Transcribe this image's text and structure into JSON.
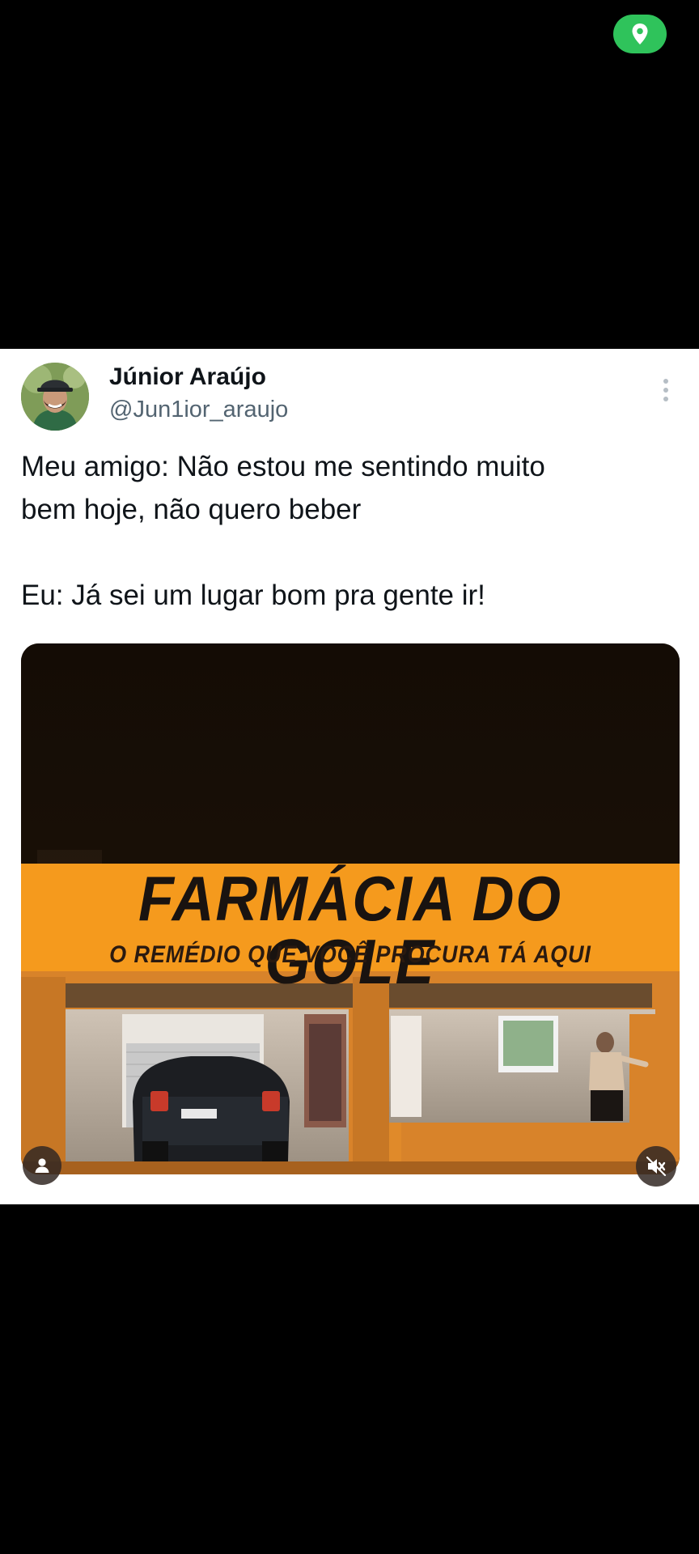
{
  "status": {
    "location_icon": "location-pin-icon",
    "accent": "#2fc35b"
  },
  "tweet": {
    "author_name": "Júnior Araújo",
    "author_handle": "@Jun1ior_araujo",
    "line1": "Meu amigo: Não estou me sentindo muito",
    "line2": "bem hoje, não quero beber",
    "line3": "Eu: Já sei um lugar bom pra gente ir!"
  },
  "media": {
    "sign_title": "FARMÁCIA DO GOLE",
    "sign_subtitle": "O REMÉDIO QUE VOCÊ PROCURA TÁ AQUI",
    "sign_color": "#f59a1d"
  },
  "controls": {
    "user_icon": "user-icon",
    "mute_icon": "volume-muted-icon"
  }
}
